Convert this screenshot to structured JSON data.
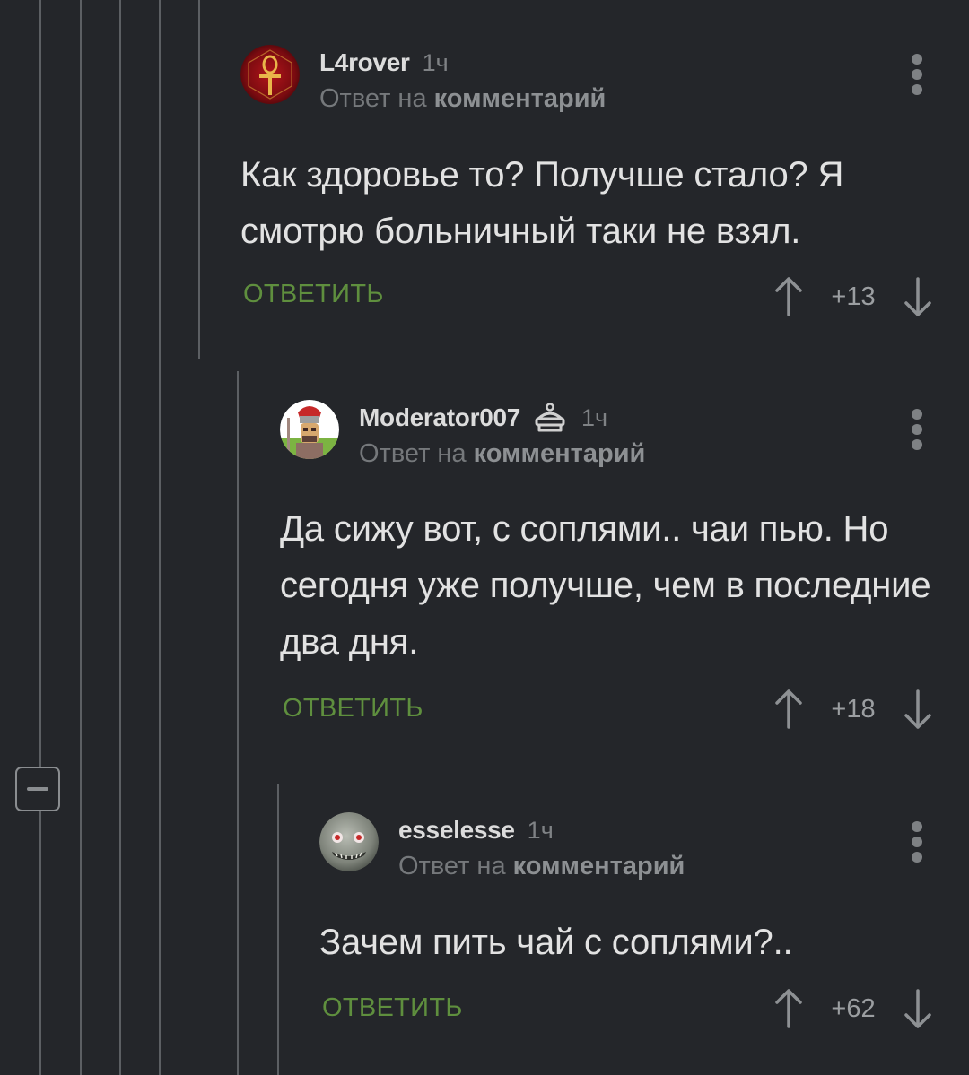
{
  "comments": [
    {
      "author": "L4rover",
      "time": "1ч",
      "reply_prefix": "Ответ на",
      "reply_link": "комментарий",
      "text": "Как здоровье то? Получше стало? Я смотрю больничный таки не взял.",
      "reply_label": "ОТВЕТИТЬ",
      "rating": "+13"
    },
    {
      "author": "Moderator007",
      "time": "1ч",
      "reply_prefix": "Ответ на",
      "reply_link": "комментарий",
      "text": "Да сижу вот, с соплями.. чаи пью. Но сегодня уже получше, чем в последние два дня.",
      "reply_label": "ОТВЕТИТЬ",
      "rating": "+18"
    },
    {
      "author": "esselesse",
      "time": "1ч",
      "reply_prefix": "Ответ на",
      "reply_link": "комментарий",
      "text": "Зачем пить чай с соплями?..",
      "reply_label": "ОТВЕТИТЬ",
      "rating": "+62"
    }
  ],
  "icons": {
    "collapse": "minus-square-icon",
    "more": "vertical-dots-icon",
    "upvote": "arrow-up-icon",
    "downvote": "arrow-down-icon",
    "moderator": "moderator-cap-icon"
  },
  "colors": {
    "background": "#24262a",
    "reply_green": "#5f8f3e",
    "text": "#e2e2e2",
    "muted": "#7f8285"
  }
}
